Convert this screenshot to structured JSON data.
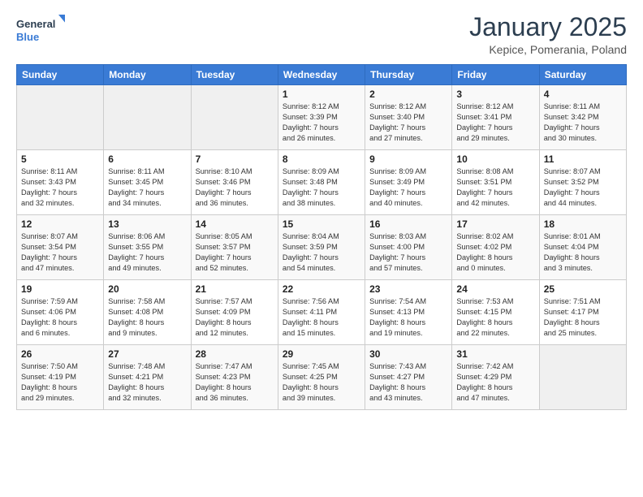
{
  "logo": {
    "general": "General",
    "blue": "Blue"
  },
  "header": {
    "title": "January 2025",
    "location": "Kepice, Pomerania, Poland"
  },
  "days_header": [
    "Sunday",
    "Monday",
    "Tuesday",
    "Wednesday",
    "Thursday",
    "Friday",
    "Saturday"
  ],
  "weeks": [
    [
      {
        "day": "",
        "info": ""
      },
      {
        "day": "",
        "info": ""
      },
      {
        "day": "",
        "info": ""
      },
      {
        "day": "1",
        "info": "Sunrise: 8:12 AM\nSunset: 3:39 PM\nDaylight: 7 hours\nand 26 minutes."
      },
      {
        "day": "2",
        "info": "Sunrise: 8:12 AM\nSunset: 3:40 PM\nDaylight: 7 hours\nand 27 minutes."
      },
      {
        "day": "3",
        "info": "Sunrise: 8:12 AM\nSunset: 3:41 PM\nDaylight: 7 hours\nand 29 minutes."
      },
      {
        "day": "4",
        "info": "Sunrise: 8:11 AM\nSunset: 3:42 PM\nDaylight: 7 hours\nand 30 minutes."
      }
    ],
    [
      {
        "day": "5",
        "info": "Sunrise: 8:11 AM\nSunset: 3:43 PM\nDaylight: 7 hours\nand 32 minutes."
      },
      {
        "day": "6",
        "info": "Sunrise: 8:11 AM\nSunset: 3:45 PM\nDaylight: 7 hours\nand 34 minutes."
      },
      {
        "day": "7",
        "info": "Sunrise: 8:10 AM\nSunset: 3:46 PM\nDaylight: 7 hours\nand 36 minutes."
      },
      {
        "day": "8",
        "info": "Sunrise: 8:09 AM\nSunset: 3:48 PM\nDaylight: 7 hours\nand 38 minutes."
      },
      {
        "day": "9",
        "info": "Sunrise: 8:09 AM\nSunset: 3:49 PM\nDaylight: 7 hours\nand 40 minutes."
      },
      {
        "day": "10",
        "info": "Sunrise: 8:08 AM\nSunset: 3:51 PM\nDaylight: 7 hours\nand 42 minutes."
      },
      {
        "day": "11",
        "info": "Sunrise: 8:07 AM\nSunset: 3:52 PM\nDaylight: 7 hours\nand 44 minutes."
      }
    ],
    [
      {
        "day": "12",
        "info": "Sunrise: 8:07 AM\nSunset: 3:54 PM\nDaylight: 7 hours\nand 47 minutes."
      },
      {
        "day": "13",
        "info": "Sunrise: 8:06 AM\nSunset: 3:55 PM\nDaylight: 7 hours\nand 49 minutes."
      },
      {
        "day": "14",
        "info": "Sunrise: 8:05 AM\nSunset: 3:57 PM\nDaylight: 7 hours\nand 52 minutes."
      },
      {
        "day": "15",
        "info": "Sunrise: 8:04 AM\nSunset: 3:59 PM\nDaylight: 7 hours\nand 54 minutes."
      },
      {
        "day": "16",
        "info": "Sunrise: 8:03 AM\nSunset: 4:00 PM\nDaylight: 7 hours\nand 57 minutes."
      },
      {
        "day": "17",
        "info": "Sunrise: 8:02 AM\nSunset: 4:02 PM\nDaylight: 8 hours\nand 0 minutes."
      },
      {
        "day": "18",
        "info": "Sunrise: 8:01 AM\nSunset: 4:04 PM\nDaylight: 8 hours\nand 3 minutes."
      }
    ],
    [
      {
        "day": "19",
        "info": "Sunrise: 7:59 AM\nSunset: 4:06 PM\nDaylight: 8 hours\nand 6 minutes."
      },
      {
        "day": "20",
        "info": "Sunrise: 7:58 AM\nSunset: 4:08 PM\nDaylight: 8 hours\nand 9 minutes."
      },
      {
        "day": "21",
        "info": "Sunrise: 7:57 AM\nSunset: 4:09 PM\nDaylight: 8 hours\nand 12 minutes."
      },
      {
        "day": "22",
        "info": "Sunrise: 7:56 AM\nSunset: 4:11 PM\nDaylight: 8 hours\nand 15 minutes."
      },
      {
        "day": "23",
        "info": "Sunrise: 7:54 AM\nSunset: 4:13 PM\nDaylight: 8 hours\nand 19 minutes."
      },
      {
        "day": "24",
        "info": "Sunrise: 7:53 AM\nSunset: 4:15 PM\nDaylight: 8 hours\nand 22 minutes."
      },
      {
        "day": "25",
        "info": "Sunrise: 7:51 AM\nSunset: 4:17 PM\nDaylight: 8 hours\nand 25 minutes."
      }
    ],
    [
      {
        "day": "26",
        "info": "Sunrise: 7:50 AM\nSunset: 4:19 PM\nDaylight: 8 hours\nand 29 minutes."
      },
      {
        "day": "27",
        "info": "Sunrise: 7:48 AM\nSunset: 4:21 PM\nDaylight: 8 hours\nand 32 minutes."
      },
      {
        "day": "28",
        "info": "Sunrise: 7:47 AM\nSunset: 4:23 PM\nDaylight: 8 hours\nand 36 minutes."
      },
      {
        "day": "29",
        "info": "Sunrise: 7:45 AM\nSunset: 4:25 PM\nDaylight: 8 hours\nand 39 minutes."
      },
      {
        "day": "30",
        "info": "Sunrise: 7:43 AM\nSunset: 4:27 PM\nDaylight: 8 hours\nand 43 minutes."
      },
      {
        "day": "31",
        "info": "Sunrise: 7:42 AM\nSunset: 4:29 PM\nDaylight: 8 hours\nand 47 minutes."
      },
      {
        "day": "",
        "info": ""
      }
    ]
  ]
}
